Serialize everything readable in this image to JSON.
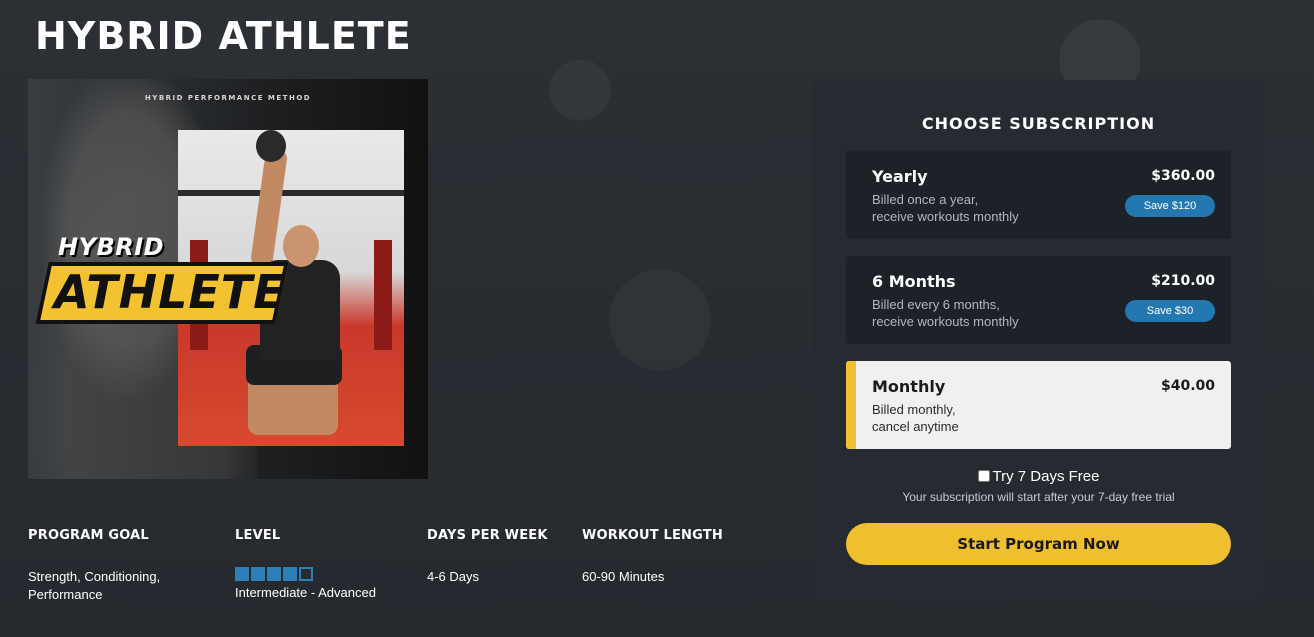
{
  "program": {
    "title": "HYBRID ATHLETE",
    "cover": {
      "tagline": "HYBRID PERFORMANCE METHOD",
      "logo_top": "HYBRID",
      "logo_main": "ATHLETE"
    }
  },
  "stats": {
    "goal": {
      "label": "PROGRAM GOAL",
      "value": "Strength, Conditioning, Performance"
    },
    "level": {
      "label": "LEVEL",
      "value": "Intermediate - Advanced",
      "filled": 4,
      "total": 5
    },
    "days": {
      "label": "DAYS PER WEEK",
      "value": "4-6 Days"
    },
    "length": {
      "label": "WORKOUT LENGTH",
      "value": "60-90 Minutes"
    }
  },
  "subscription": {
    "title": "CHOOSE SUBSCRIPTION",
    "plans": [
      {
        "name": "Yearly",
        "desc_line1": "Billed once a year,",
        "desc_line2": "receive workouts monthly",
        "price": "$360.00",
        "badge": "Save $120",
        "selected": false
      },
      {
        "name": "6 Months",
        "desc_line1": "Billed every 6 months,",
        "desc_line2": "receive workouts monthly",
        "price": "$210.00",
        "badge": "Save $30",
        "selected": false
      },
      {
        "name": "Monthly",
        "desc_line1": "Billed monthly,",
        "desc_line2": "cancel anytime",
        "price": "$40.00",
        "badge": "",
        "selected": true
      }
    ],
    "trial_label": "Try 7 Days Free",
    "trial_checked": false,
    "trial_note": "Your subscription will start after your 7-day free trial",
    "cta_label": "Start Program Now"
  },
  "colors": {
    "accent": "#f0bf2f",
    "badge": "#2478b0",
    "level_dot": "#2e7fb8",
    "background": "#2a2e33"
  }
}
